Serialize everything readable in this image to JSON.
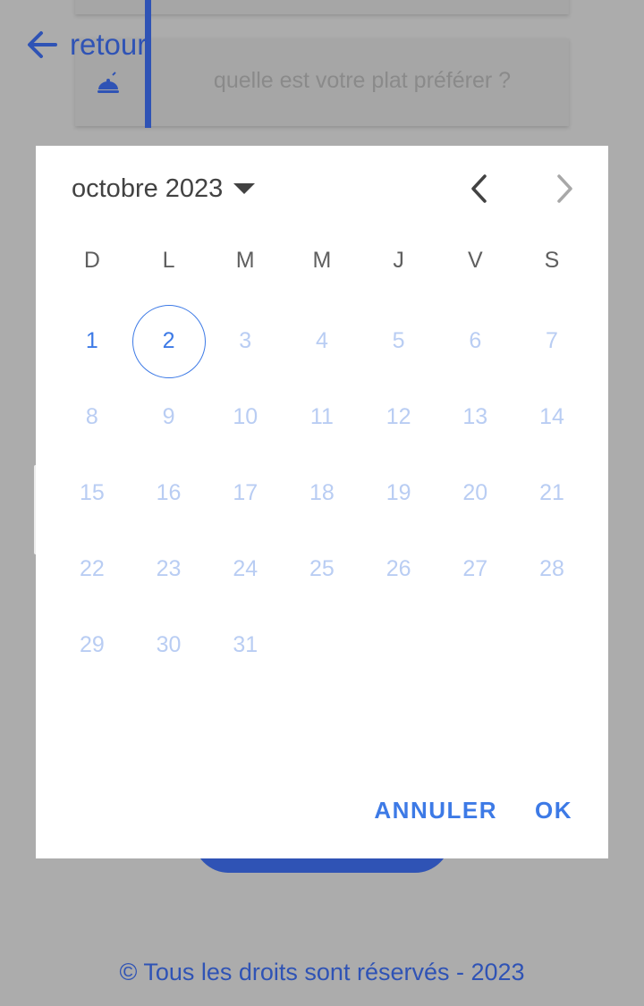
{
  "background": {
    "back_label": "retour",
    "field_placeholder": "quelle est votre plat préférer ?",
    "footer": "© Tous les droits sont réservés - 2023"
  },
  "dialog": {
    "month_label": "octobre 2023",
    "weekdays": [
      "D",
      "L",
      "M",
      "M",
      "J",
      "V",
      "S"
    ],
    "leading_blanks": 0,
    "days": [
      "1",
      "2",
      "3",
      "4",
      "5",
      "6",
      "7",
      "8",
      "9",
      "10",
      "11",
      "12",
      "13",
      "14",
      "15",
      "16",
      "17",
      "18",
      "19",
      "20",
      "21",
      "22",
      "23",
      "24",
      "25",
      "26",
      "27",
      "28",
      "29",
      "30",
      "31"
    ],
    "today": "2",
    "enabled_days": [
      "1",
      "2"
    ],
    "cancel_label": "ANNULER",
    "ok_label": "OK"
  },
  "colors": {
    "accent": "#3d7ae6",
    "brand": "#2f53b5",
    "disabled_day": "#b9cdf3",
    "scrim": "#acacac"
  },
  "icons": {
    "back": "arrow-left-icon",
    "field": "food-icon",
    "caret": "caret-down-icon",
    "prev": "chevron-left-icon",
    "next": "chevron-right-icon"
  }
}
